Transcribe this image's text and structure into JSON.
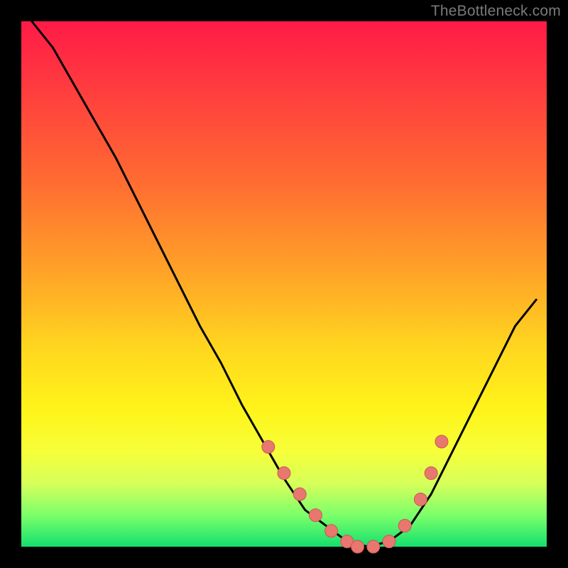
{
  "watermark": "TheBottleneck.com",
  "colors": {
    "background": "#000000",
    "gradient_top": "#ff1a47",
    "gradient_bottom": "#14e06e",
    "curve": "#000000",
    "marker_fill": "#e8776f",
    "marker_stroke": "#c85a52"
  },
  "chart_data": {
    "type": "line",
    "title": "",
    "xlabel": "",
    "ylabel": "",
    "xlim": [
      0,
      100
    ],
    "ylim": [
      0,
      100
    ],
    "grid": false,
    "legend_position": "none",
    "series": [
      {
        "name": "bottleneck-curve",
        "x": [
          2,
          6,
          10,
          14,
          18,
          22,
          26,
          30,
          34,
          38,
          42,
          46,
          50,
          54,
          58,
          62,
          66,
          70,
          74,
          78,
          82,
          86,
          90,
          94,
          98
        ],
        "values": [
          100,
          95,
          88,
          81,
          74,
          66,
          58,
          50,
          42,
          35,
          27,
          20,
          13,
          7,
          4,
          1,
          0,
          1,
          4,
          10,
          18,
          26,
          34,
          42,
          47
        ]
      }
    ],
    "markers": {
      "name": "highlighted-points",
      "x": [
        47,
        50,
        53,
        56,
        59,
        62,
        64,
        67,
        70,
        73,
        76,
        78,
        80
      ],
      "values": [
        19,
        14,
        10,
        6,
        3,
        1,
        0,
        0,
        1,
        4,
        9,
        14,
        20
      ]
    }
  }
}
